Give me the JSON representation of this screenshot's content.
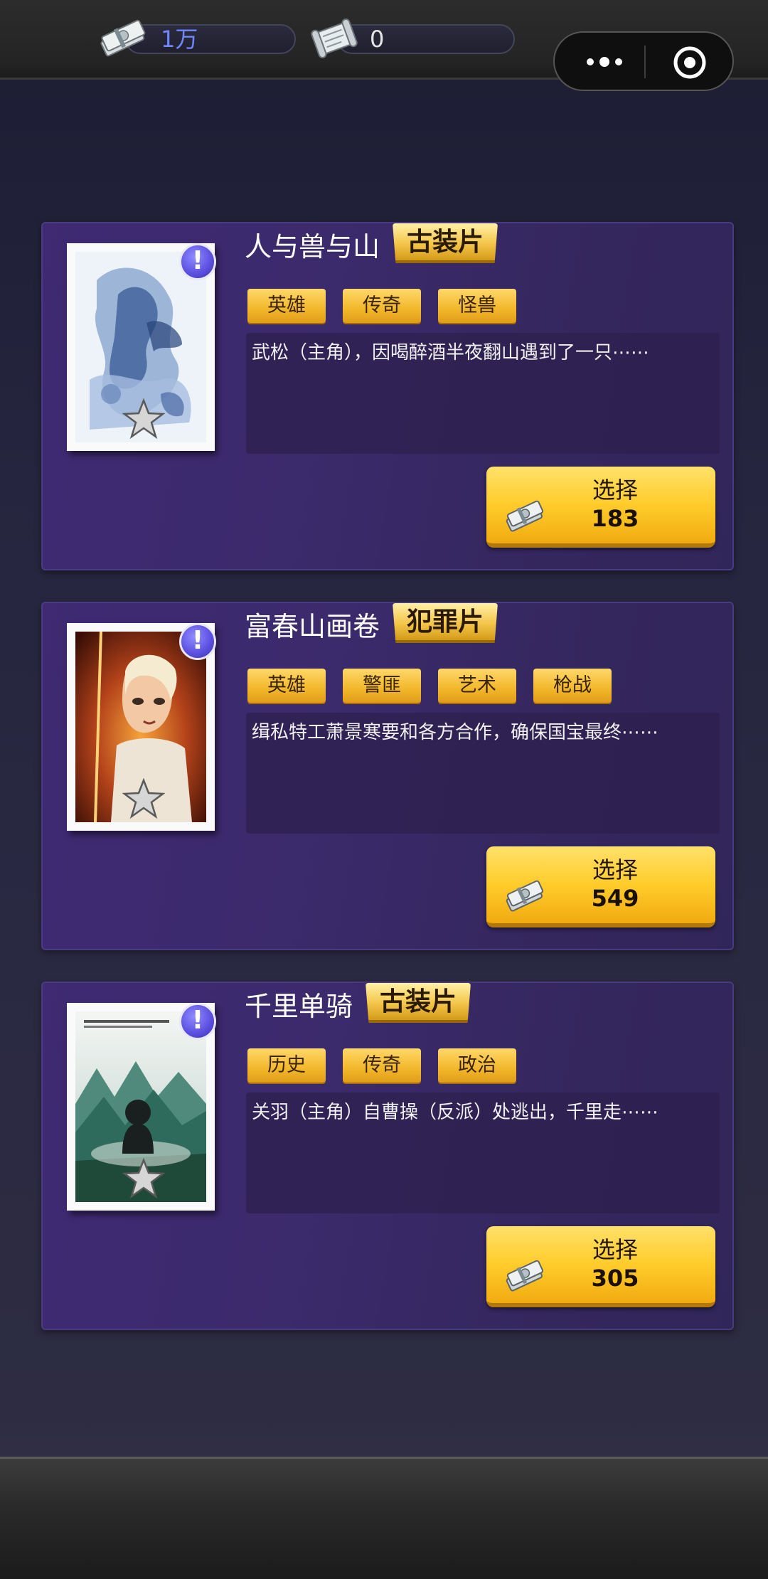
{
  "header": {
    "cash": {
      "icon": "cash-bundle-icon",
      "value": "1万"
    },
    "scroll": {
      "icon": "scroll-icon",
      "value": "0"
    },
    "capsule": {
      "more_icon": "more-dots-icon",
      "close_icon": "target-icon"
    }
  },
  "movies": [
    {
      "title": "人与兽与山",
      "genre": "古装片",
      "tags": [
        "英雄",
        "传奇",
        "怪兽"
      ],
      "description": "武松（主角），因喝醉酒半夜翻山遇到了一只⋯⋯",
      "badge": "!",
      "select_label": "选择",
      "price": "183",
      "poster_icon": "tiger-ink-poster"
    },
    {
      "title": "富春山画卷",
      "genre": "犯罪片",
      "tags": [
        "英雄",
        "警匪",
        "艺术",
        "枪战"
      ],
      "description": "缉私特工萧景寒要和各方合作，确保国宝最终⋯⋯",
      "badge": "!",
      "select_label": "选择",
      "price": "549",
      "poster_icon": "swordsman-poster"
    },
    {
      "title": "千里单骑",
      "genre": "古装片",
      "tags": [
        "历史",
        "传奇",
        "政治"
      ],
      "description": "关羽（主角）自曹操（反派）处逃出，千里走⋯⋯",
      "badge": "!",
      "select_label": "选择",
      "price": "305",
      "poster_icon": "mountain-silhouette-poster"
    }
  ]
}
